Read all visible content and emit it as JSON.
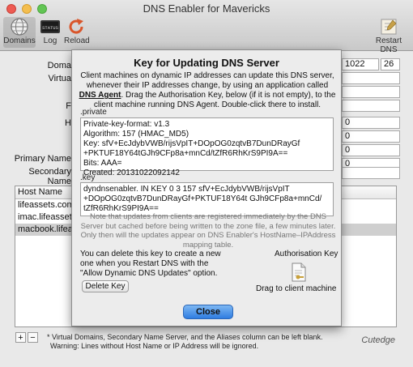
{
  "window": {
    "title": "DNS Enabler for Mavericks"
  },
  "toolbar": {
    "domains_label": "Domains",
    "log_label": "Log",
    "reload_label": "Reload",
    "restart_label": "Restart DNS",
    "log_icon_text": "STATUS"
  },
  "background": {
    "label_domain": "Doma",
    "label_virtual": "Virtua",
    "label_f": "F",
    "label_h": "H",
    "label_primary": "Primary Name",
    "label_secondary": "Secondary Name",
    "serial_value": "1022",
    "serial_value2": "26",
    "field_value_1": "0",
    "field_value_2": "0",
    "field_value_3": "0",
    "field_value_4": "0",
    "host_table": {
      "header": "Host Name",
      "rows": [
        "lifeassets.com",
        "imac.lifeassets.c",
        "macbook.lifeass"
      ]
    },
    "footnote_line1": "* Virtual Domains, Secondary Name Server, and the Aliases column can be left blank.",
    "footnote_line2": "Warning: Lines without Host Name or IP Address will be ignored.",
    "brand": "Cutedge",
    "plus": "+",
    "minus": "−"
  },
  "sheet": {
    "title": "Key for Updating DNS Server",
    "intro_part1": "Client machines on dynamic IP addresses can update this DNS server, whenever their IP addresses change, by using an application called ",
    "intro_link": "DNS Agent",
    "intro_part2": ". Drag the Authorisation Key, below (if it is not empty), to the client machine running DNS Agent. Double-click there to install.",
    "private_label": ".private",
    "private_text": "Private-key-format: v1.3\nAlgorithm: 157 (HMAC_MD5)\nKey: sfV+EcJdybVWB/rijsVpIT+DOpOG0zqtvB7DunDRayGf\n+PKTUF18Y64tGJh9CFp8a+mnCd/tZfR6RhKrS9PI9A==\nBits: AAA=\nCreated: 20131022092142",
    "key_label": ".key",
    "key_text": "dyndnsenabler. IN KEY 0 3 157 sfV+EcJdybVWB/rijsVpIT\n+DOpOG0zqtvB7DunDRayGf+PKTUF18Y64t GJh9CFp8a+mnCd/\ntZfR6RhKrS9PI9A==",
    "note": "Note that updates from clients are registered immediately by the DNS Server but cached before being written to the zone file, a few minutes later. Only then will the updates appear on DNS Enabler's HostName–IPAddress mapping table.",
    "delete_text": "You can delete this key to create a new one when you Restart DNS with the \"Allow Dynamic DNS Updates\" option.",
    "delete_button": "Delete Key",
    "auth_label": "Authorisation Key",
    "drag_label": "Drag to client machine",
    "close_button": "Close"
  },
  "colors": {
    "accent": "#2f7de1"
  }
}
